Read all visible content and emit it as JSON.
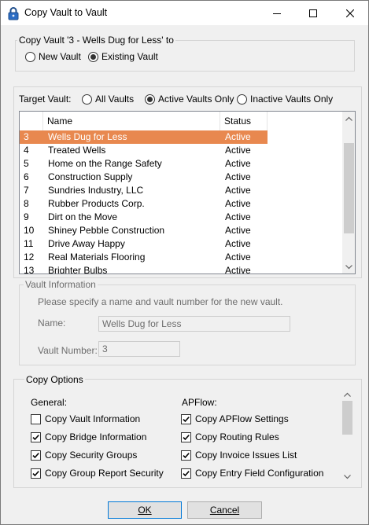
{
  "window": {
    "title": "Copy Vault to Vault",
    "icon": "lock-icon"
  },
  "copy_mode": {
    "legend": "Copy Vault '3 - Wells Dug for Less' to",
    "options": [
      {
        "label": "New Vault",
        "selected": false
      },
      {
        "label": "Existing Vault",
        "selected": true
      }
    ]
  },
  "target_vault": {
    "label": "Target Vault:",
    "filters": [
      {
        "label": "All Vaults",
        "selected": false
      },
      {
        "label": "Active Vaults Only",
        "selected": true
      },
      {
        "label": "Inactive Vaults Only",
        "selected": false
      }
    ],
    "columns": [
      "",
      "Name",
      "Status"
    ],
    "rows": [
      {
        "id": "3",
        "name": "Wells Dug for Less",
        "status": "Active",
        "selected": true
      },
      {
        "id": "4",
        "name": "Treated Wells",
        "status": "Active"
      },
      {
        "id": "5",
        "name": "Home on the Range Safety",
        "status": "Active"
      },
      {
        "id": "6",
        "name": "Construction Supply",
        "status": "Active"
      },
      {
        "id": "7",
        "name": "Sundries Industry, LLC",
        "status": "Active"
      },
      {
        "id": "8",
        "name": "Rubber Products Corp.",
        "status": "Active"
      },
      {
        "id": "9",
        "name": "Dirt on the Move",
        "status": "Active"
      },
      {
        "id": "10",
        "name": "Shiney Pebble Construction",
        "status": "Active"
      },
      {
        "id": "11",
        "name": "Drive Away Happy",
        "status": "Active"
      },
      {
        "id": "12",
        "name": "Real Materials Flooring",
        "status": "Active"
      },
      {
        "id": "13",
        "name": "Brighter Bulbs",
        "status": "Active"
      }
    ]
  },
  "vault_info": {
    "legend": "Vault Information",
    "instructions": "Please specify a name and vault number for the new vault.",
    "name_label": "Name:",
    "name_value": "Wells Dug for Less",
    "number_label": "Vault Number:",
    "number_value": "3"
  },
  "copy_options": {
    "legend": "Copy Options",
    "general_heading": "General:",
    "apflow_heading": "APFlow:",
    "general": [
      {
        "label": "Copy Vault Information",
        "checked": false
      },
      {
        "label": "Copy Bridge Information",
        "checked": true
      },
      {
        "label": "Copy Security Groups",
        "checked": true
      },
      {
        "label": "Copy Group Report Security",
        "checked": true
      }
    ],
    "apflow": [
      {
        "label": "Copy APFlow Settings",
        "checked": true
      },
      {
        "label": "Copy Routing Rules",
        "checked": true
      },
      {
        "label": "Copy Invoice Issues List",
        "checked": true
      },
      {
        "label": "Copy Entry Field Configuration",
        "checked": true
      }
    ]
  },
  "buttons": {
    "ok": "OK",
    "cancel": "Cancel"
  },
  "colors": {
    "selection": "#e8884f",
    "accent": "#0078d7"
  }
}
